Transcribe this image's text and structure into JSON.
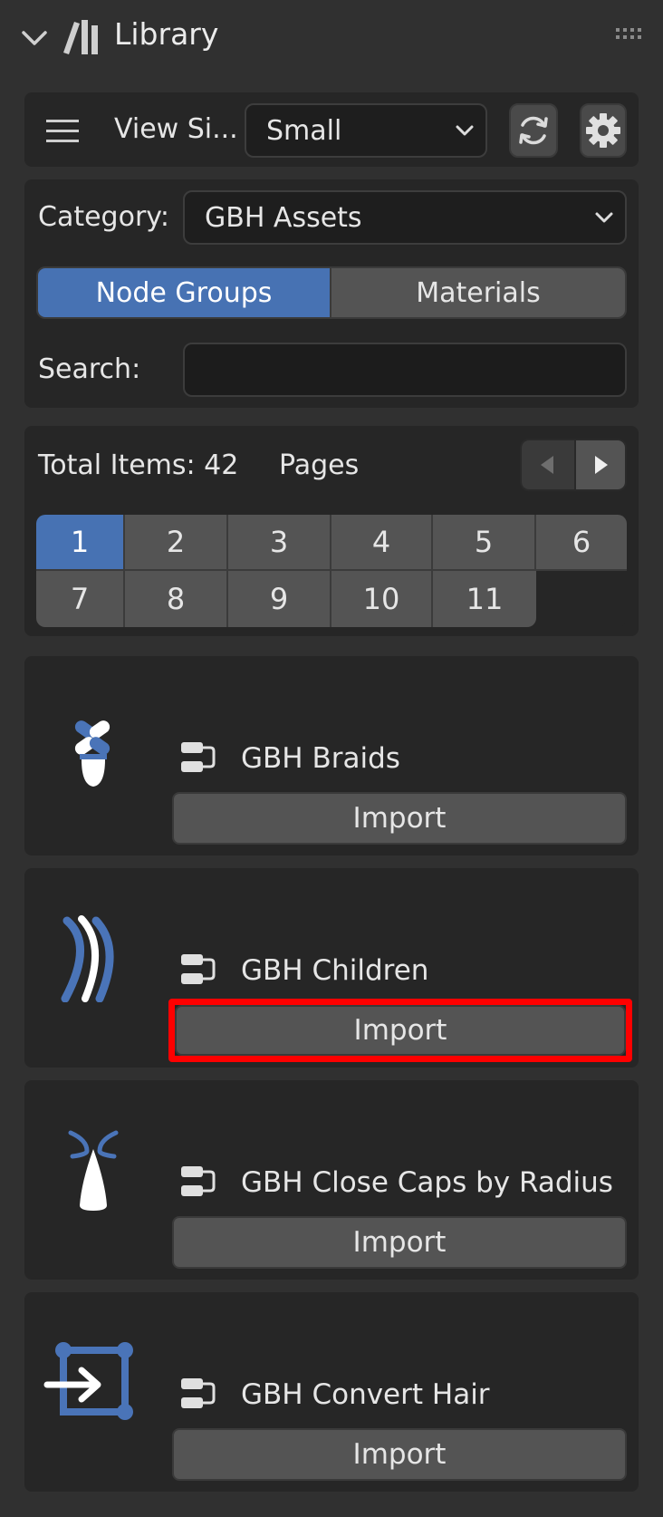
{
  "header": {
    "title": "Library"
  },
  "toolbar": {
    "view_size_label": "View Si...",
    "view_size_value": "Small"
  },
  "filters": {
    "category_label": "Category:",
    "category_value": "GBH Assets",
    "tabs": [
      {
        "label": "Node Groups",
        "active": true
      },
      {
        "label": "Materials",
        "active": false
      }
    ],
    "search_label": "Search:",
    "search_value": ""
  },
  "pagination": {
    "total_items_text": "Total Items: 42",
    "pages_label": "Pages",
    "pages": [
      "1",
      "2",
      "3",
      "4",
      "5",
      "6",
      "7",
      "8",
      "9",
      "10",
      "11"
    ],
    "current_page": "1"
  },
  "assets": [
    {
      "name": "GBH Braids",
      "button": "Import",
      "icon": "braids-icon",
      "highlighted": false
    },
    {
      "name": "GBH Children",
      "button": "Import",
      "icon": "children-icon",
      "highlighted": true
    },
    {
      "name": "GBH Close Caps by Radius",
      "button": "Import",
      "icon": "close-caps-icon",
      "highlighted": false
    },
    {
      "name": "GBH Convert Hair",
      "button": "Import",
      "icon": "convert-hair-icon",
      "highlighted": false
    }
  ],
  "colors": {
    "accent": "#4772b3",
    "panel": "#262626",
    "background": "#303030",
    "button": "#545454",
    "highlight": "#ff0000"
  }
}
